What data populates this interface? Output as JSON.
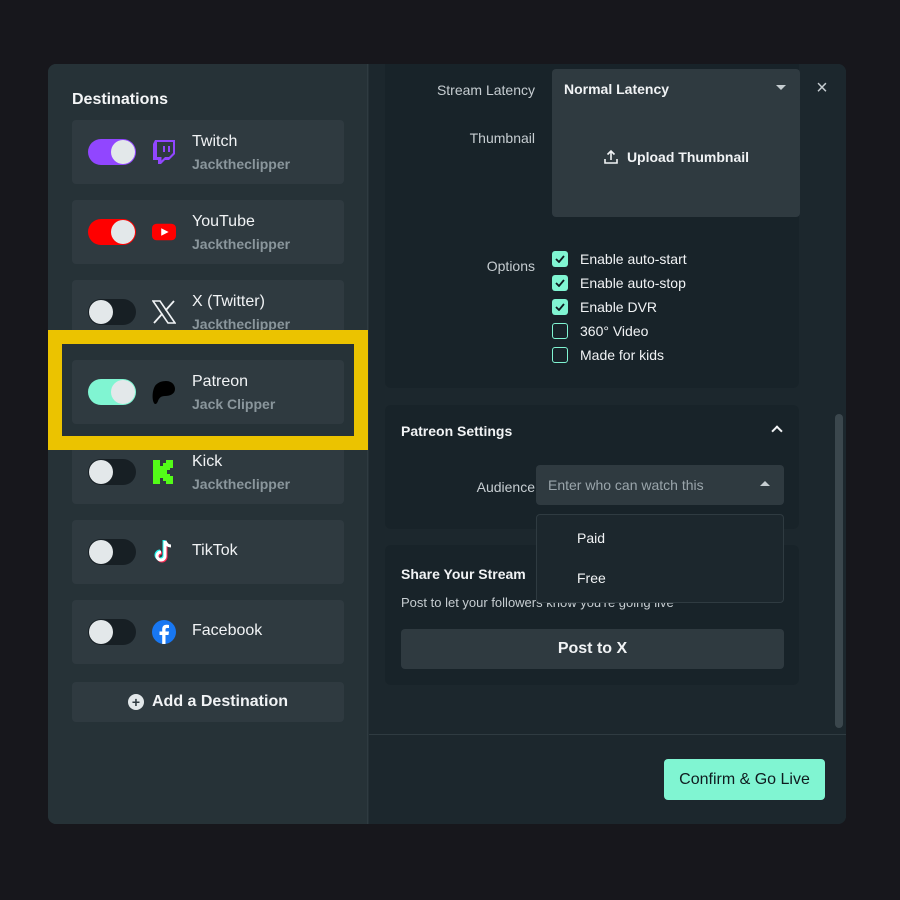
{
  "left": {
    "title": "Destinations",
    "destinations": [
      {
        "name": "Twitch",
        "account": "Jacktheclipper",
        "enabled": true,
        "toggle_color": "#9146ff",
        "icon": "twitch-icon"
      },
      {
        "name": "YouTube",
        "account": "Jacktheclipper",
        "enabled": true,
        "toggle_color": "#ff0000",
        "icon": "youtube-icon"
      },
      {
        "name": "X (Twitter)",
        "account": "Jacktheclipper",
        "enabled": false,
        "icon": "x-icon"
      },
      {
        "name": "Patreon",
        "account": "Jack Clipper",
        "enabled": true,
        "toggle_color": "#80f5d2",
        "icon": "patreon-icon"
      },
      {
        "name": "Kick",
        "account": "Jacktheclipper",
        "enabled": false,
        "icon": "kick-icon"
      },
      {
        "name": "TikTok",
        "account": "",
        "enabled": false,
        "icon": "tiktok-icon"
      },
      {
        "name": "Facebook",
        "account": "",
        "enabled": false,
        "icon": "facebook-icon"
      }
    ],
    "add_label": "Add a Destination"
  },
  "settings": {
    "latency_label": "Stream Latency",
    "latency_value": "Normal Latency",
    "thumbnail_label": "Thumbnail",
    "upload_label": "Upload Thumbnail",
    "options_label": "Options",
    "options": [
      {
        "label": "Enable auto-start",
        "checked": true
      },
      {
        "label": "Enable auto-stop",
        "checked": true
      },
      {
        "label": "Enable DVR",
        "checked": true
      },
      {
        "label": "360° Video",
        "checked": false
      },
      {
        "label": "Made for kids",
        "checked": false
      }
    ]
  },
  "patreon": {
    "title": "Patreon Settings",
    "audience_label": "Audience",
    "audience_placeholder": "Enter who can watch this",
    "audience_options": [
      "Paid",
      "Free"
    ]
  },
  "share": {
    "title": "Share Your Stream",
    "description": "Post to let your followers know you're going live",
    "button": "Post to X"
  },
  "footer": {
    "go_live": "Confirm & Go Live"
  },
  "colors": {
    "accent": "#80f5d2",
    "highlight": "#ebc300"
  }
}
